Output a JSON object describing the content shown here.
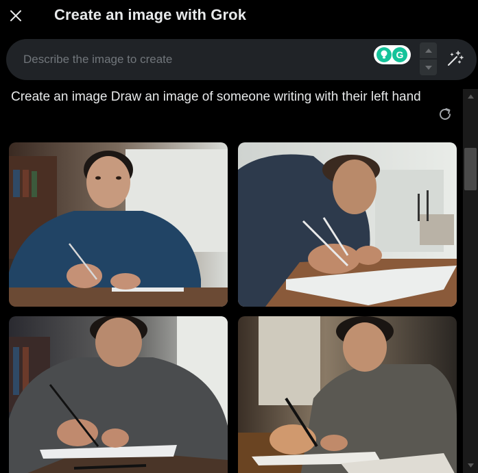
{
  "header": {
    "title": "Create an image with Grok",
    "close_icon": "close-icon"
  },
  "prompt": {
    "value": "",
    "placeholder": "Describe the image to create"
  },
  "extension": {
    "logo_letter": "G",
    "color": "#15c39a"
  },
  "result": {
    "prompt_text": "Create an image Draw an image of someone writing with their left hand",
    "refresh_icon": "refresh-icon"
  },
  "images": [
    {
      "index": 1,
      "subject": "man-blue-sweater-writing"
    },
    {
      "index": 2,
      "subject": "man-navy-shirt-writing-notebook"
    },
    {
      "index": 3,
      "subject": "man-grey-sweater-writing"
    },
    {
      "index": 4,
      "subject": "man-grey-sweater-writing-warm-light"
    }
  ],
  "colors": {
    "background": "#000000",
    "input_bg": "#202327",
    "text": "#e7e9ea",
    "placeholder": "#71767b"
  }
}
